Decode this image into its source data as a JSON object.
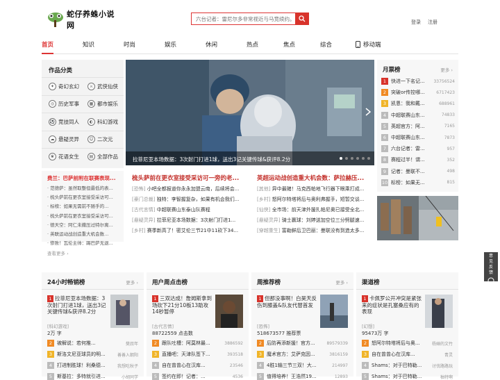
{
  "header": {
    "site_name": "蛇仔养蛛小说网",
    "search_placeholder": "六台记者：雷尼尔多非常视近与马竞续约。",
    "login": "登录",
    "register": "注册"
  },
  "nav": {
    "items": [
      "首页",
      "知识",
      "时尚",
      "娱乐",
      "休闲",
      "热点",
      "焦点",
      "综合",
      "移动端"
    ],
    "active": "首页"
  },
  "categories": {
    "title": "作品分类",
    "items": [
      "奇幻玄幻",
      "武侠仙侠",
      "历史军事",
      "都市娱乐",
      "竞技同人",
      "科幻游戏",
      "悬疑灵异",
      "二次元",
      "花语女生",
      "全部作品"
    ]
  },
  "hotlist": {
    "headline": "费兰：巴萨前附在联赛表现...",
    "items": [
      "· 范德萨：虽然取整但最低的表...",
      "· 梳头萨前在更衣室接受采访可...",
      "· 标榜：如果无需前不随手的...",
      "· 梳头萨前在更衣室接受采访可...",
      "· 德天空：阿仁未撒压过特尔离...",
      "· 英联运动战创造重大机会数...",
      "· 惨败！瓦伦主帅：踢巴萨无退..."
    ],
    "more": "查看更多 ›"
  },
  "slider": {
    "caption": "拉菲尼亚本场数据：3次射门打进1球，送出3记关键传球&获评8.2分"
  },
  "news": {
    "col1": {
      "headline": "梳头萨前在更衣室接受采访可一旁的老...",
      "items": [
        {
          "tag": "[恐怖]",
          "text": "小吧全都报道你永永加盟云南，后续将会..."
        },
        {
          "tag": "[豪门总裁]",
          "text": "独特：李智握复杂，如果有机会我们..."
        },
        {
          "tag": "[古代言情]",
          "text": "中超联赛山东泰山队赛程"
        },
        {
          "tag": "[悬疑灵异]",
          "text": "拉菲尼亚本场数据：3次射门打进1..."
        },
        {
          "tag": "[乡村]",
          "text": "赛季新高了！密艾伦三节21中11砍下34..."
        }
      ]
    },
    "col2": {
      "headline": "英超运动战创造重大机会数：萨拉赫压...",
      "items": [
        {
          "tag": "[其他]",
          "text": "异中最赌！马克西帕地飞行器下眼乘打成..."
        },
        {
          "tag": "[乡村]",
          "text": "怒阿尔特塔将后与奥利弗握手，短暂交谈..."
        },
        {
          "tag": "[仙侠]",
          "text": "全市场：前天津外援扎帕尼奥已接受全北..."
        },
        {
          "tag": "[悬疑灵异]",
          "text": "骑士赢球：刘婷送加空位三分劈腿速..."
        },
        {
          "tag": "[穿越重生]",
          "text": "富勒鲜后卫巴丽：曼联没有到造太多..."
        }
      ]
    }
  },
  "monthly_rank": {
    "title": "月票榜",
    "more": "更多 ›",
    "items": [
      {
        "n": "1",
        "title": "快进一下名记...",
        "count": "33756524"
      },
      {
        "n": "2",
        "title": "突破or传控哪...",
        "count": "6717423"
      },
      {
        "n": "3",
        "title": "凯恩：我和戴...",
        "count": "688961"
      },
      {
        "n": "4",
        "title": "中超联赛山东...",
        "count": "74833"
      },
      {
        "n": "5",
        "title": "英超官方：阿...",
        "count": "7165"
      },
      {
        "n": "6",
        "title": "中超联赛山东...",
        "count": "7873"
      },
      {
        "n": "7",
        "title": "六台记者：雷...",
        "count": "957"
      },
      {
        "n": "8",
        "title": "赛程过半！谓...",
        "count": "352"
      },
      {
        "n": "9",
        "title": "记者：曼联不...",
        "count": "498"
      },
      {
        "n": "10",
        "title": "标榜：如果无...",
        "count": "815"
      }
    ]
  },
  "side_widget": {
    "label": "意见反馈"
  },
  "panels": [
    {
      "title": "24小时畅销榜",
      "more": "更多 ›",
      "top": "拉菲尼亚本场数据：3次射门打进1球，送出3记关键传球&获评8.2分",
      "tag": "[科幻游戏]",
      "stat": "2万",
      "unit": "字",
      "items": [
        {
          "n": "2",
          "t": "被解说：若何推...",
          "c": "樊叔年"
        },
        {
          "n": "3",
          "t": "斯洛文尼亚球员的明...",
          "c": "善善入朝阳"
        },
        {
          "n": "4",
          "t": "打进制胜球！利桑德...",
          "c": "我想吃秋子"
        },
        {
          "n": "5",
          "t": "斯基拉：多特就引进...",
          "c": "小胡同学"
        }
      ]
    },
    {
      "title": "用户周点击榜",
      "more": "",
      "top": "三双达成！詹姆斯拿到场砍下21分10板13助攻14秒暂停",
      "tag": "[古代言情]",
      "stat": "88722559",
      "unit": "点击数",
      "items": [
        {
          "n": "2",
          "t": "跟队吐槽：阿莫林最...",
          "c": "3886592"
        },
        {
          "n": "3",
          "t": "直播吧：天津队签下...",
          "c": "393518"
        },
        {
          "n": "4",
          "t": "自在曾曾心在汉库...",
          "c": "23546"
        },
        {
          "n": "5",
          "t": "签约在即！记者：...",
          "c": "4536"
        }
      ]
    },
    {
      "title": "周推荐榜",
      "more": "更多 ›",
      "top": "但那没事啊！白昊天反伤到膝盖&队友代替首发",
      "tag": "[恐怖]",
      "stat": "518673577",
      "unit": "推荐票",
      "items": [
        {
          "n": "2",
          "t": "后防再添新援！官方...",
          "c": "89579339"
        },
        {
          "n": "3",
          "t": "魔术官方：艾萨克因...",
          "c": "3816159"
        },
        {
          "n": "4",
          "t": "4胜1输三节三双！大...",
          "c": "214997"
        },
        {
          "n": "5",
          "t": "值得培养！王浩然19...",
          "c": "12893"
        }
      ]
    },
    {
      "title": "渠道榜",
      "more": "",
      "top": "卡佩罗公开冲突是紧张来的症状是孔塞桑应有的表现",
      "tag": "[幻想]",
      "stat": "95473万",
      "unit": "字",
      "items": [
        {
          "n": "2",
          "t": "怒阿尔特塔将后与奥...",
          "c": "杨婵的文竹"
        },
        {
          "n": "3",
          "t": "自在曾曾心在汉库...",
          "c": "青灵"
        },
        {
          "n": "4",
          "t": "Shams：对于巴特勒...",
          "c": "讨伐路路玩"
        },
        {
          "n": "5",
          "t": "Shams：对于巴特勒...",
          "c": "柚特啊"
        }
      ]
    }
  ]
}
